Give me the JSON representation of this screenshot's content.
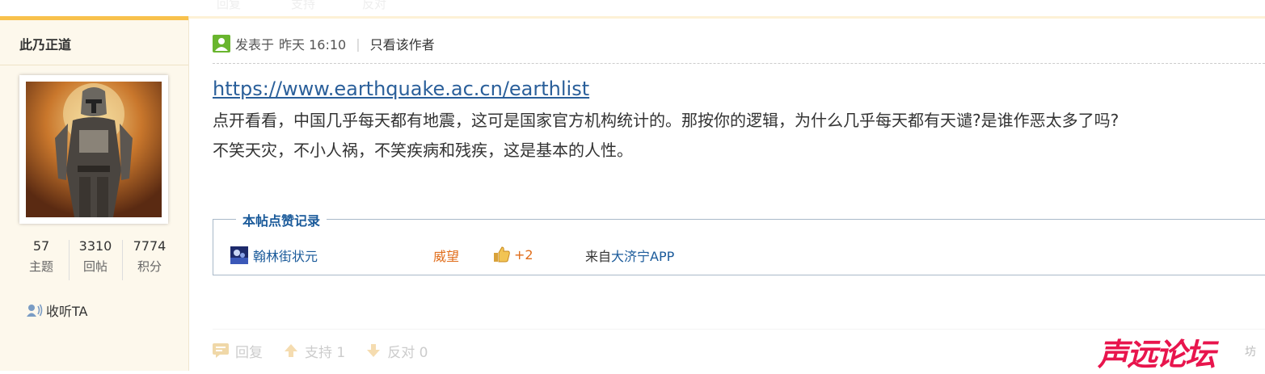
{
  "top_ghost": {
    "reply": "回复",
    "support": "支持",
    "oppose": "反对"
  },
  "sidebar": {
    "username": "此乃正道",
    "stats": [
      {
        "value": "57",
        "label": "主题"
      },
      {
        "value": "3310",
        "label": "回帖"
      },
      {
        "value": "7774",
        "label": "积分"
      }
    ],
    "follow_label": "收听TA"
  },
  "post": {
    "meta_prefix": "发表于",
    "meta_time": "昨天 16:10",
    "meta_only_author": "只看该作者",
    "link": "https://www.earthquake.ac.cn/earthlist",
    "line1": "点开看看，中国几乎每天都有地震，这可是国家官方机构统计的。那按你的逻辑，为什么几乎每天都有天谴?是谁作恶太多了吗?",
    "line2": "不笑天灾，不小人祸，不笑疾病和残疾，这是基本的人性。"
  },
  "likes": {
    "legend": "本帖点赞记录",
    "user": "翰林街状元",
    "type": "威望",
    "amount": "+2",
    "source_prefix": "来自",
    "source_app": "大济宁APP"
  },
  "actions": {
    "reply": "回复",
    "support": "支持 1",
    "oppose": "反对 0"
  },
  "watermark": {
    "text": "声远论坛",
    "tail": "坊"
  },
  "colors": {
    "accent": "#f8c14c",
    "link": "#2a5f9a",
    "orange": "#e06d1b",
    "watermark": "#e8154d"
  }
}
